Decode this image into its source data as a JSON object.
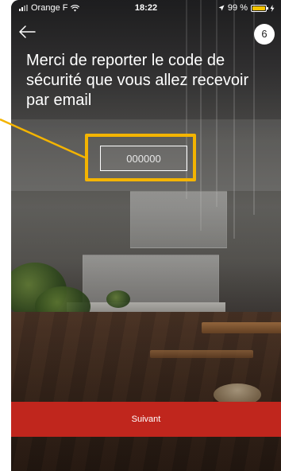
{
  "status_bar": {
    "carrier": "Orange F",
    "time": "18:22",
    "battery": "99 %",
    "battery_level": 0.99
  },
  "header": {
    "step": "6"
  },
  "instruction": "Merci de reporter le code de sécurité que vous allez recevoir par email",
  "code_field": {
    "placeholder": "000000",
    "value": ""
  },
  "actions": {
    "next_label": "Suivant"
  },
  "colors": {
    "highlight": "#f4b400",
    "button": "#c0261d"
  },
  "icons": [
    "signal-icon",
    "wifi-icon",
    "location-icon",
    "battery-icon",
    "charging-icon",
    "back-arrow-icon"
  ]
}
